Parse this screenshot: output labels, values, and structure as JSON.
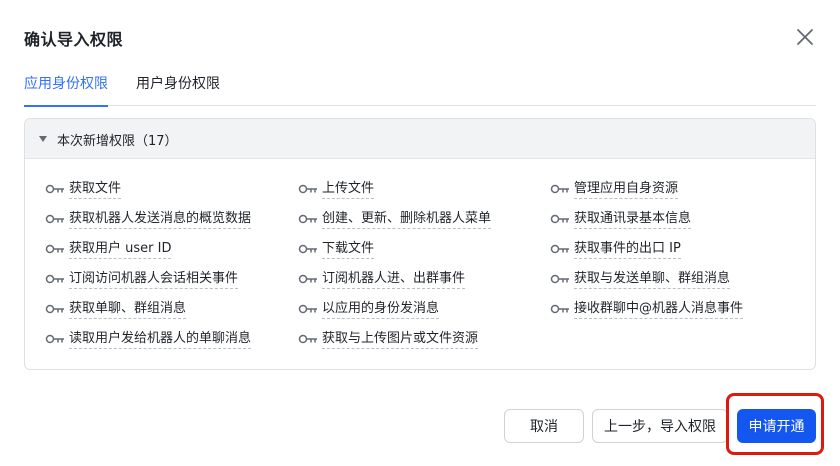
{
  "dialog": {
    "title": "确认导入权限",
    "close_icon": "close-icon"
  },
  "tabs": [
    {
      "label": "应用身份权限",
      "active": true
    },
    {
      "label": "用户身份权限",
      "active": false
    }
  ],
  "panel": {
    "title": "本次新增权限（17）",
    "expanded": true,
    "permissions": [
      "获取文件",
      "获取机器人发送消息的概览数据",
      "获取用户 user ID",
      "订阅访问机器人会话相关事件",
      "获取单聊、群组消息",
      "读取用户发给机器人的单聊消息",
      "上传文件",
      "创建、更新、删除机器人菜单",
      "下载文件",
      "订阅机器人进、出群事件",
      "以应用的身份发消息",
      "获取与上传图片或文件资源",
      "管理应用自身资源",
      "获取通讯录基本信息",
      "获取事件的出口 IP",
      "获取与发送单聊、群组消息",
      "接收群聊中@机器人消息事件"
    ]
  },
  "footer": {
    "cancel_label": "取消",
    "prev_label": "上一步，导入权限",
    "apply_label": "申请开通"
  },
  "colors": {
    "accent": "#3370ff",
    "primary_button": "#1456f0",
    "highlight_box": "#e0190f"
  }
}
